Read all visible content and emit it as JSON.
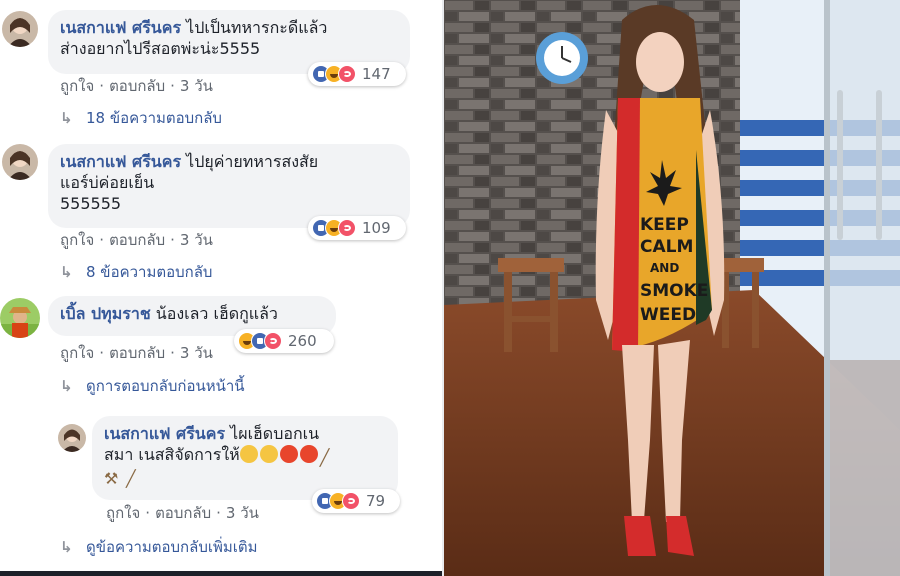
{
  "comments": [
    {
      "author": "เนสกาแฟ ศรีนคร",
      "text_line1": "ไปเป็นทหารกะดีแล้ว",
      "text_line2": "ส่างอยากไปรีสอตพ่ะน่ะ5555",
      "like": "ถูกใจ",
      "reply": "ตอบกลับ",
      "time": "3 วัน",
      "reaction_count": "147",
      "replies_link": "18 ข้อความตอบกลับ"
    },
    {
      "author": "เนสกาแฟ ศรีนคร",
      "text_line1": "ไปยุค่ายทหารสงสัย",
      "text_line2": "แอร์บ่ค่อยเย็น",
      "text_line3": "555555",
      "like": "ถูกใจ",
      "reply": "ตอบกลับ",
      "time": "3 วัน",
      "reaction_count": "109",
      "replies_link": "8 ข้อความตอบกลับ"
    },
    {
      "author": "เบิ้ล ปทุมราช",
      "text": "น้องเลว เฮ็ดกูแล้ว",
      "like": "ถูกใจ",
      "reply": "ตอบกลับ",
      "time": "3 วัน",
      "reaction_count": "260",
      "previous_replies_link": "ดูการตอบกลับก่อนหน้านี้"
    }
  ],
  "reply_comment": {
    "author": "เนสกาแฟ ศรีนคร",
    "text_line1": "ไผเฮ็ดบอกเน",
    "text_line2": "สมา เนสสิจัดการให้",
    "like": "ถูกใจ",
    "reply": "ตอบกลับ",
    "time": "3 วัน",
    "reaction_count": "79",
    "more_replies_link": "ดูข้อความตอบกลับเพิ่มเติม"
  },
  "photo": {
    "clock_label": "",
    "shirt_text_line1": "KEEP",
    "shirt_text_line2": "CALM",
    "shirt_text_line3": "AND",
    "shirt_text_line4": "SMOKE",
    "shirt_text_line5": "WEED"
  },
  "colors": {
    "link_blue": "#365899",
    "bubble_bg": "#f2f3f5",
    "meta_gray": "#616770"
  }
}
